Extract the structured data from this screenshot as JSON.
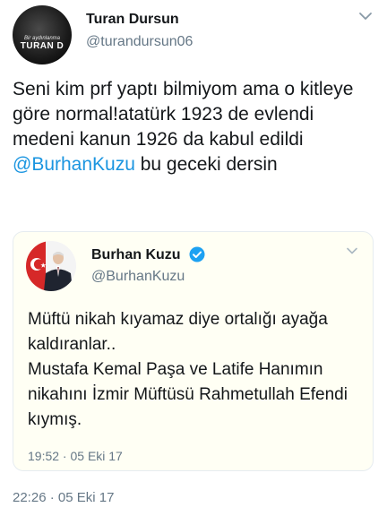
{
  "author": {
    "avatar_small_text": "Bir aydınlanma",
    "avatar_big_text": "TURAN D",
    "name": "Turan Dursun",
    "handle": "@turandursun06"
  },
  "tweet": {
    "text_before": "Seni kim prf yaptı bilmiyom ama o kitleye göre normal!atatürk 1923 de evlendi medeni kanun 1926 da kabul edildi ",
    "mention": "@BurhanKuzu",
    "text_after": " bu geceki dersin",
    "timestamp": "22:26 · 05 Eki 17"
  },
  "quoted_tweet": {
    "name": "Burhan Kuzu",
    "handle": "@BurhanKuzu",
    "text": "Müftü nikah kıyamaz diye ortalığı ayağa kaldıranlar..\nMustafa Kemal Paşa ve Latife Hanımın nikahını İzmir Müftüsü Rahmetullah Efendi kıymış.",
    "timestamp": "19:52 · 05 Eki 17"
  },
  "icons": {
    "caret": "chevron-down-icon",
    "verified": "verified-badge-icon"
  },
  "colors": {
    "link": "#1b95e0",
    "secondary_text": "#657786",
    "quote_bg": "#fffff4"
  }
}
